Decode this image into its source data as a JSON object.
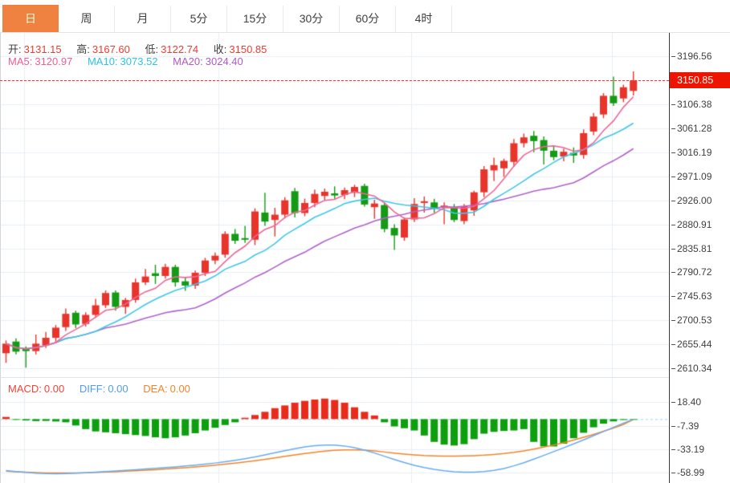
{
  "tabbar": {
    "tabs": [
      {
        "label": "日",
        "active": true
      },
      {
        "label": "周",
        "active": false
      },
      {
        "label": "月",
        "active": false
      },
      {
        "label": "5分",
        "active": false
      },
      {
        "label": "15分",
        "active": false
      },
      {
        "label": "30分",
        "active": false
      },
      {
        "label": "60分",
        "active": false
      },
      {
        "label": "4时",
        "active": false
      }
    ]
  },
  "ohlc_legend": {
    "items": [
      {
        "label": "开:",
        "value": "3131.15"
      },
      {
        "label": "高:",
        "value": "3167.60"
      },
      {
        "label": "低:",
        "value": "3122.74"
      },
      {
        "label": "收:",
        "value": "3150.85"
      }
    ]
  },
  "ma_legend": {
    "items": [
      {
        "label": "MA5:",
        "value": "3120.97"
      },
      {
        "label": "MA10:",
        "value": "3073.52"
      },
      {
        "label": "MA20:",
        "value": "3024.40"
      }
    ]
  },
  "macd_legend": {
    "items": [
      {
        "label": "MACD:",
        "value": "0.00"
      },
      {
        "label": "DIFF:",
        "value": "0.00"
      },
      {
        "label": "DEA:",
        "value": "0.00"
      }
    ]
  },
  "price_marker": {
    "value": "3150.85"
  },
  "colors": {
    "candle_up": "#e8342b",
    "candle_down": "#149a14",
    "ma5": "#ee6695",
    "ma10": "#3fc6e8",
    "ma20": "#ae63c9",
    "macd_bar_up": "#e92b1c",
    "macd_bar_down": "#0d9f0d",
    "diff_line": "#68abf0",
    "dea_line": "#f08628",
    "zero_line": "#8fd8ef",
    "price_line": "#f23535",
    "price_tag_bg": "#ee1500",
    "tab_active_bg": "#ef8240",
    "legend_value_red": "#f23b30"
  },
  "chart_data": [
    {
      "type": "candlestick",
      "panel": "main",
      "grid": true,
      "legend_position": "top-left",
      "y_ticks": [
        3196.56,
        3106.38,
        3061.28,
        3016.19,
        2971.09,
        2926.0,
        2880.91,
        2835.81,
        2790.72,
        2745.63,
        2700.53,
        2655.44,
        2610.34
      ],
      "current_price": 3150.85,
      "ylim": [
        2594.3,
        3240.0
      ],
      "series": [
        {
          "name": "K线",
          "type": "candlestick",
          "last_bar": {
            "open": 3131.15,
            "high": 3167.6,
            "low": 3122.74,
            "close": 3150.85
          },
          "ohlc": [
            [
              2639,
              2663,
              2621,
              2657
            ],
            [
              2661,
              2667,
              2637,
              2642
            ],
            [
              2647,
              2652,
              2612,
              2643
            ],
            [
              2643,
              2674,
              2637,
              2657
            ],
            [
              2654,
              2679,
              2649,
              2668
            ],
            [
              2668,
              2692,
              2661,
              2687
            ],
            [
              2688,
              2723,
              2681,
              2713
            ],
            [
              2715,
              2719,
              2686,
              2693
            ],
            [
              2694,
              2716,
              2689,
              2711
            ],
            [
              2711,
              2741,
              2706,
              2729
            ],
            [
              2729,
              2757,
              2724,
              2752
            ],
            [
              2753,
              2757,
              2719,
              2726
            ],
            [
              2726,
              2743,
              2713,
              2739
            ],
            [
              2739,
              2779,
              2734,
              2772
            ],
            [
              2772,
              2797,
              2767,
              2783
            ],
            [
              2789,
              2805,
              2769,
              2784
            ],
            [
              2784,
              2807,
              2779,
              2801
            ],
            [
              2801,
              2805,
              2764,
              2772
            ],
            [
              2774,
              2782,
              2756,
              2766
            ],
            [
              2766,
              2794,
              2760,
              2790
            ],
            [
              2790,
              2818,
              2784,
              2813
            ],
            [
              2813,
              2828,
              2806,
              2822
            ],
            [
              2824,
              2868,
              2818,
              2863
            ],
            [
              2863,
              2872,
              2844,
              2850
            ],
            [
              2855,
              2878,
              2846,
              2852
            ],
            [
              2852,
              2911,
              2842,
              2905
            ],
            [
              2903,
              2940,
              2878,
              2886
            ],
            [
              2889,
              2912,
              2858,
              2899
            ],
            [
              2899,
              2932,
              2892,
              2926
            ],
            [
              2943,
              2949,
              2894,
              2902
            ],
            [
              2902,
              2929,
              2896,
              2921
            ],
            [
              2921,
              2946,
              2913,
              2938
            ],
            [
              2934,
              2948,
              2927,
              2942
            ],
            [
              2939,
              2952,
              2929,
              2935
            ],
            [
              2936,
              2950,
              2928,
              2945
            ],
            [
              2940,
              2955,
              2932,
              2951
            ],
            [
              2953,
              2957,
              2914,
              2918
            ],
            [
              2913,
              2927,
              2891,
              2920
            ],
            [
              2917,
              2922,
              2866,
              2872
            ],
            [
              2874,
              2881,
              2833,
              2860
            ],
            [
              2856,
              2894,
              2850,
              2890
            ],
            [
              2890,
              2930,
              2885,
              2919
            ],
            [
              2921,
              2933,
              2903,
              2924
            ],
            [
              2922,
              2929,
              2902,
              2911
            ],
            [
              2912,
              2922,
              2881,
              2916
            ],
            [
              2913,
              2919,
              2885,
              2889
            ],
            [
              2887,
              2919,
              2881,
              2915
            ],
            [
              2907,
              2944,
              2897,
              2941
            ],
            [
              2941,
              2990,
              2932,
              2984
            ],
            [
              2982,
              3006,
              2962,
              2992
            ],
            [
              2986,
              3004,
              2970,
              3000
            ],
            [
              2998,
              3041,
              2989,
              3033
            ],
            [
              3033,
              3051,
              3025,
              3044
            ],
            [
              3047,
              3056,
              3016,
              3037
            ],
            [
              3039,
              3046,
              2993,
              3019
            ],
            [
              3019,
              3027,
              3001,
              3007
            ],
            [
              3008,
              3023,
              2999,
              3017
            ],
            [
              3015,
              3025,
              2996,
              3010
            ],
            [
              3011,
              3059,
              3004,
              3052
            ],
            [
              3055,
              3090,
              3048,
              3083
            ],
            [
              3087,
              3127,
              3080,
              3122
            ],
            [
              3122,
              3158,
              3103,
              3108
            ],
            [
              3117,
              3143,
              3110,
              3138
            ],
            [
              3131.15,
              3167.6,
              3122.74,
              3150.85
            ]
          ]
        },
        {
          "name": "MA5",
          "type": "line",
          "window": 5,
          "current": 3120.97
        },
        {
          "name": "MA10",
          "type": "line",
          "window": 10,
          "current": 3073.52
        },
        {
          "name": "MA20",
          "type": "line",
          "window": 20,
          "current": 3024.4
        }
      ]
    },
    {
      "type": "macd",
      "panel": "sub",
      "grid": true,
      "y_ticks": [
        18.4,
        -7.39,
        -33.19,
        -58.99
      ],
      "ylim": [
        -70.1,
        46.1
      ],
      "series": [
        {
          "name": "MACD",
          "type": "bar",
          "current": 0.0,
          "values": [
            2.4,
            -0.8,
            -1.5,
            -2.2,
            -2,
            -2.6,
            -3.5,
            -7,
            -11,
            -13.5,
            -14.5,
            -15.5,
            -16.5,
            -17.5,
            -18.5,
            -20,
            -21,
            -20,
            -18,
            -15.5,
            -12.5,
            -9.5,
            -6.5,
            -3.5,
            1.5,
            4.5,
            8,
            12,
            15,
            18,
            20,
            21.5,
            22.5,
            21,
            18,
            13,
            8,
            4,
            -3.5,
            -8,
            -10,
            -12.5,
            -18,
            -25,
            -28,
            -29,
            -27.5,
            -22,
            -16,
            -14,
            -13,
            -12.5,
            -11,
            -25,
            -30,
            -30,
            -27,
            -21,
            -15,
            -9,
            -5,
            -2.5,
            -1,
            -0.3
          ]
        },
        {
          "name": "DIFF",
          "type": "line",
          "current": 0.0,
          "values": [
            -56.5,
            -57.5,
            -58.5,
            -59.3,
            -59.8,
            -60,
            -59.7,
            -59.3,
            -58.8,
            -58.2,
            -57.6,
            -57,
            -56.3,
            -55.6,
            -54.8,
            -54,
            -53.2,
            -52.4,
            -51.5,
            -50.5,
            -49.4,
            -48.2,
            -46.8,
            -45.2,
            -43.4,
            -41.4,
            -39.2,
            -36.9,
            -34.6,
            -32.4,
            -30.5,
            -29.1,
            -28.4,
            -28.5,
            -29.5,
            -31.4,
            -34,
            -37.2,
            -40.7,
            -44.3,
            -47.7,
            -50.7,
            -53.2,
            -55.2,
            -56.7,
            -57.7,
            -58.2,
            -58.2,
            -57.6,
            -56.3,
            -54.2,
            -51.3,
            -47.8,
            -43.9,
            -39.8,
            -35.7,
            -31.5,
            -27.2,
            -22.8,
            -18.2,
            -13.6,
            -9,
            -4.4,
            -0.2
          ]
        },
        {
          "name": "DEA",
          "type": "line",
          "current": 0.0,
          "values": [
            -57.2,
            -57.8,
            -58.3,
            -58.7,
            -59,
            -59.1,
            -59.1,
            -59,
            -58.8,
            -58.5,
            -58.1,
            -57.7,
            -57.2,
            -56.7,
            -56.1,
            -55.5,
            -54.8,
            -54.1,
            -53.3,
            -52.5,
            -51.6,
            -50.6,
            -49.5,
            -48.3,
            -47,
            -45.6,
            -44.1,
            -42.5,
            -40.9,
            -39.3,
            -37.8,
            -36.4,
            -35.2,
            -34.3,
            -33.8,
            -33.7,
            -34.1,
            -34.9,
            -36.1,
            -37.3,
            -38.4,
            -39.3,
            -40,
            -40.4,
            -40.6,
            -40.6,
            -40.4,
            -40.1,
            -39.6,
            -38.8,
            -37.8,
            -36.5,
            -34.9,
            -33,
            -30.8,
            -28.4,
            -25.8,
            -23,
            -20,
            -16.8,
            -13.4,
            -9.8,
            -5.8,
            -0.5
          ]
        }
      ]
    }
  ]
}
